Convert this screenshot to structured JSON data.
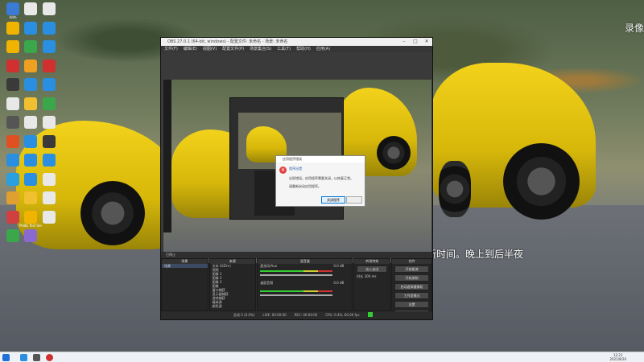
{
  "desktop": {
    "overlay_top_right": "录像",
    "overlay_caption": "新时间。晚上到后半夜",
    "icons_left": [
      {
        "label": "Adm",
        "color": "#3a7bd5"
      },
      {
        "label": "",
        "color": "#e8e8e8"
      },
      {
        "label": "",
        "color": "#e8e8e8"
      },
      {
        "label": "",
        "color": "#f0b400"
      },
      {
        "label": "",
        "color": "#2a8fe0"
      },
      {
        "label": "",
        "color": "#2a8fe0"
      },
      {
        "label": "",
        "color": "#f0b400"
      },
      {
        "label": "",
        "color": "#3aa84a"
      },
      {
        "label": "",
        "color": "#2a8fe0"
      },
      {
        "label": "",
        "color": "#d03030"
      },
      {
        "label": "",
        "color": "#f0a020"
      },
      {
        "label": "",
        "color": "#d03030"
      },
      {
        "label": "",
        "color": "#3a3a3a"
      },
      {
        "label": "",
        "color": "#2a8fe0"
      },
      {
        "label": "",
        "color": "#2a8fe0"
      },
      {
        "label": "",
        "color": "#e8e8e8"
      },
      {
        "label": "",
        "color": "#f0c030"
      },
      {
        "label": "",
        "color": "#3aa84a"
      },
      {
        "label": "",
        "color": "#555555"
      },
      {
        "label": "",
        "color": "#e8e8e8"
      },
      {
        "label": "",
        "color": "#e8e8e8"
      },
      {
        "label": "",
        "color": "#e05020"
      },
      {
        "label": "",
        "color": "#2a8fe0"
      },
      {
        "label": "",
        "color": "#3a3a3a"
      },
      {
        "label": "",
        "color": "#2a8fe0"
      },
      {
        "label": "",
        "color": "#2a8fe0"
      },
      {
        "label": "",
        "color": "#2a8fe0"
      },
      {
        "label": "",
        "color": "#2aa0e0"
      },
      {
        "label": "",
        "color": "#2a8fe0"
      },
      {
        "label": "",
        "color": "#e8e8e8"
      },
      {
        "label": "",
        "color": "#e0a030"
      },
      {
        "label": "",
        "color": "#f0c030"
      },
      {
        "label": "",
        "color": "#e8e8e8"
      },
      {
        "label": "",
        "color": "#d04040"
      },
      {
        "label": "PUBG Test Server",
        "color": "#f0b400"
      },
      {
        "label": "",
        "color": "#e8e8e8"
      },
      {
        "label": "",
        "color": "#3aa84a"
      },
      {
        "label": "",
        "color": "#8a6ad0"
      }
    ]
  },
  "obs": {
    "title": "OBS 27.0.1 (64-bit, windows) - 配置文件: 未命名 - 场景: 未命名",
    "menu": [
      "文件(F)",
      "编辑(E)",
      "视图(V)",
      "配置文件(P)",
      "场景集合(S)",
      "工具(T)",
      "帮助(H)",
      "应用(A)"
    ],
    "toolbar_text": "已停止",
    "dialog": {
      "title": "应用程序错误",
      "heading": "程序出错",
      "message_1": "出现错误。应用程序需要关闭，以恢复正常。",
      "message_2": "请重新启动应用程序。",
      "button": "关闭程序"
    },
    "panels": {
      "scenes": {
        "header": "场景",
        "items": [
          "场景"
        ]
      },
      "sources": {
        "header": "来源",
        "items": [
          "文本 (GDI+)",
          "视频",
          "图像 1",
          "图像 2",
          "图像 3",
          "图像",
          "窗口捕获",
          "显示器捕获",
          "游戏捕获",
          "媒体源",
          "颜色源"
        ]
      },
      "mixer": {
        "header": "混音器",
        "tracks": [
          {
            "name": "麦克风/Aux",
            "db": "0.0 dB"
          },
          {
            "name": "桌面音频",
            "db": "0.0 dB"
          }
        ]
      },
      "transitions": {
        "header": "转场特效",
        "type": "淡入淡出",
        "duration_label": "时长",
        "duration": "300 ms"
      },
      "controls": {
        "header": "控件",
        "buttons": [
          "开始推流",
          "开始录制",
          "启动虚拟摄像机",
          "工作室模式",
          "设置",
          "退出"
        ]
      }
    },
    "status": [
      "丢帧 0 (0.0%)",
      "LIVE: 00:00:00",
      "REC: 00:00:00",
      "CPU: 0.4%, 60.00 fps"
    ],
    "status_colors": {
      "green": "#33cc33"
    }
  },
  "taskbar": {
    "time": "12:21",
    "date": "2021/8/26"
  }
}
